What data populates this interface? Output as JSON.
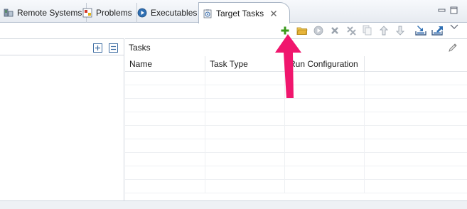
{
  "tabs": [
    {
      "label": "Remote Systems",
      "icon": "remote-systems-icon",
      "active": false
    },
    {
      "label": "Problems",
      "icon": "problems-icon",
      "active": false
    },
    {
      "label": "Executables",
      "icon": "executables-icon",
      "active": false
    },
    {
      "label": "Target Tasks",
      "icon": "target-tasks-icon",
      "active": true
    }
  ],
  "toolbar": {
    "buttons": [
      {
        "name": "add-task",
        "icon": "green-plus-icon",
        "enabled": true
      },
      {
        "name": "open-folder",
        "icon": "folder-icon",
        "enabled": true
      },
      {
        "name": "run",
        "icon": "run-icon",
        "enabled": false
      },
      {
        "name": "delete",
        "icon": "delete-x-icon",
        "enabled": false
      },
      {
        "name": "remove-all",
        "icon": "remove-all-icon",
        "enabled": false
      },
      {
        "name": "copy",
        "icon": "copy-icon",
        "enabled": false
      },
      {
        "name": "move-up",
        "icon": "arrow-up-icon",
        "enabled": false
      },
      {
        "name": "move-down",
        "icon": "arrow-down-icon",
        "enabled": false
      },
      {
        "name": "import",
        "icon": "import-icon",
        "enabled": true
      },
      {
        "name": "export",
        "icon": "export-icon",
        "enabled": true
      }
    ]
  },
  "tasks_panel": {
    "title": "Tasks",
    "columns": [
      "Name",
      "Task Type",
      "Run Configuration",
      ""
    ],
    "rows": []
  },
  "colors": {
    "accent_pink": "#f0166d",
    "add_green": "#3a9a1a",
    "folder_yellow": "#e7b43a",
    "disabled_gray": "#9aa3ad",
    "tab_border": "#aab6c6"
  }
}
